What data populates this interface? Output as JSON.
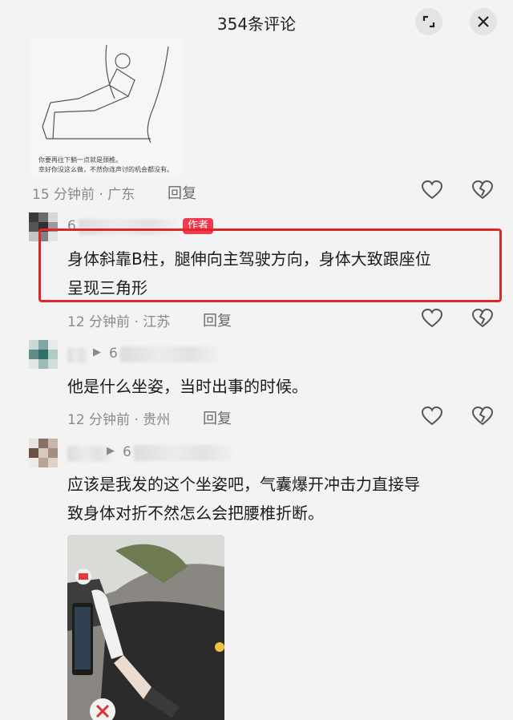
{
  "header": {
    "title": "354条评论"
  },
  "top_image": {
    "caption_line1": "你要再往下躺一点就是颈椎。",
    "caption_line2": "幸好你没这么做，不然你连声讨的机会都没有。"
  },
  "comments": [
    {
      "meta": "15 分钟前 · 广东",
      "reply": "回复"
    },
    {
      "name_start": "6",
      "badge": "作者",
      "text_line1": "身体斜靠B柱，腿伸向主驾驶方向，身体大致跟座位",
      "text_line2": "呈现三角形",
      "meta": "12 分钟前 · 江苏",
      "reply": "回复"
    },
    {
      "reply_arrow": "▶",
      "name_start": "6",
      "text_line1": "他是什么坐姿，当时出事的时候。",
      "meta": "12 分钟前 · 贵州",
      "reply": "回复"
    },
    {
      "reply_arrow": "▶",
      "name_start": "6",
      "text_line1": "应该是我发的这个坐姿吧，气囊爆开冲击力直接导",
      "text_line2": "致身体对折不然怎么会把腰椎折断。"
    }
  ],
  "colors": {
    "highlight": "#e0262b",
    "badge": "#f23a4e",
    "background": "#f3f3f3"
  }
}
